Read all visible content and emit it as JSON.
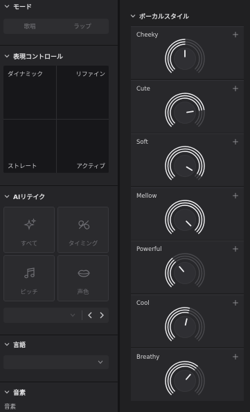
{
  "left": {
    "mode": {
      "title": "モード",
      "options": [
        "歌唱",
        "ラップ"
      ]
    },
    "expression": {
      "title": "表現コントロール",
      "top_left": "ダイナミック",
      "top_right": "リファイン",
      "bottom_left": "ストレート",
      "bottom_right": "アクティブ"
    },
    "ai_retake": {
      "title": "AIリテイク",
      "tiles": [
        {
          "label": "すべて",
          "icon": "sparkles-icon"
        },
        {
          "label": "タイミング",
          "icon": "timing-icon"
        },
        {
          "label": "ピッチ",
          "icon": "music-note-icon"
        },
        {
          "label": "声色",
          "icon": "lips-icon"
        }
      ]
    },
    "language": {
      "title": "言語"
    },
    "phoneme": {
      "title": "音素",
      "label": "音素"
    }
  },
  "right": {
    "vocal_style": {
      "title": "ボーカルスタイル",
      "styles": [
        {
          "name": "Cheeky",
          "level": 0.5
        },
        {
          "name": "Cute",
          "level": 0.8
        },
        {
          "name": "Soft",
          "level": 0.95
        },
        {
          "name": "Mellow",
          "level": 1.0
        },
        {
          "name": "Powerful",
          "level": 0.35
        },
        {
          "name": "Cool",
          "level": 0.55
        },
        {
          "name": "Breathy",
          "level": 0.65
        }
      ]
    }
  }
}
